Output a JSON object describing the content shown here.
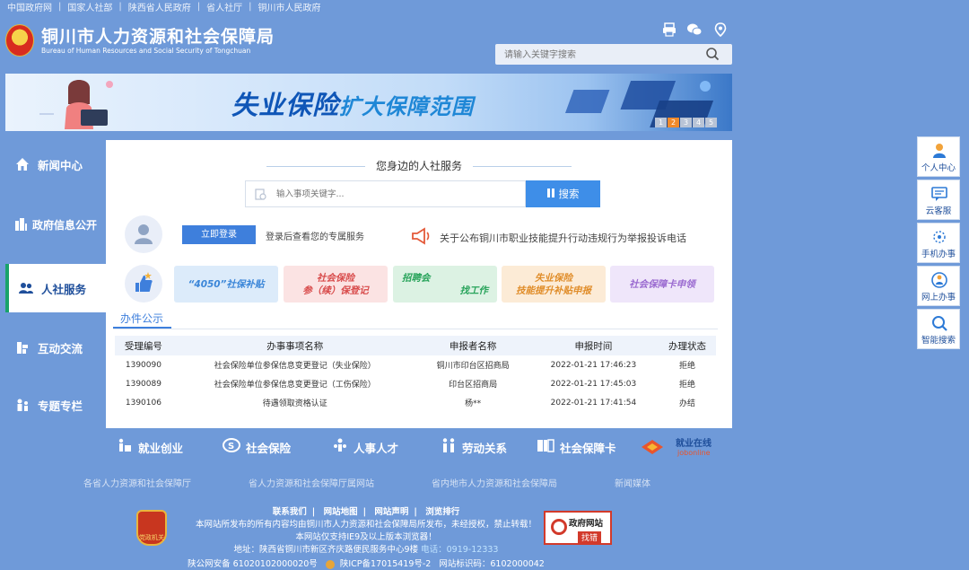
{
  "top_links": [
    "中国政府网",
    "国家人社部",
    "陕西省人民政府",
    "省人社厅",
    "铜川市人民政府"
  ],
  "header": {
    "title": "铜川市人力资源和社会保障局",
    "subtitle": "Bureau of Human Resources and Social Security of Tongchuan",
    "search_placeholder": "请输入关键字搜索",
    "icons": [
      "printer-icon",
      "wechat-icon",
      "location-icon"
    ]
  },
  "banner": {
    "title_main": "失业保险",
    "title_sub": "扩大保障范围",
    "pages": [
      "1",
      "2",
      "3",
      "4",
      "5"
    ],
    "active_page": "2"
  },
  "left_nav": [
    {
      "label": "新闻中心",
      "icon": "home-icon"
    },
    {
      "label": "政府信息公开",
      "icon": "building-icon"
    },
    {
      "label": "人社服务",
      "icon": "people-icon",
      "active": true
    },
    {
      "label": "互动交流",
      "icon": "chat-icon"
    },
    {
      "label": "专题专栏",
      "icon": "topic-icon"
    }
  ],
  "panel": {
    "heading": "您身边的人社服务",
    "search_placeholder": "输入事项关键字...",
    "search_button": "搜索",
    "login_button": "立即登录",
    "login_hint": "登录后查看您的专属服务",
    "notice": "关于公布铜川市职业技能提升行动违规行为举报投诉电话",
    "tiles": [
      {
        "line1": "“4050”社保补贴",
        "line2": "",
        "color": "#3b86d8",
        "bg": "#dcebfa"
      },
      {
        "line1": "社会保险",
        "line2": "参（续）保登记",
        "color": "#d84b4b",
        "bg": "#fbe3e3"
      },
      {
        "line1": "招聘会",
        "line2": "找工作",
        "color": "#27a35a",
        "bg": "#dcf2e3"
      },
      {
        "line1": "失业保险",
        "line2": "技能提升补贴申报",
        "color": "#e08d2a",
        "bg": "#fcebd6"
      },
      {
        "line1": "社会保障卡申领",
        "line2": "",
        "color": "#9a6ad0",
        "bg": "#efe6fa"
      }
    ],
    "pub_tab": "办件公示",
    "table": {
      "headers": [
        "受理编号",
        "办事事项名称",
        "申报者名称",
        "申报时间",
        "办理状态"
      ],
      "rows": [
        [
          "1390090",
          "社会保险单位参保信息变更登记（失业保险）",
          "铜川市印台区招商局",
          "2022-01-21 17:46:23",
          "拒绝"
        ],
        [
          "1390089",
          "社会保险单位参保信息变更登记（工伤保险）",
          "印台区招商局",
          "2022-01-21 17:45:03",
          "拒绝"
        ],
        [
          "1390106",
          "待遇领取资格认证",
          "杨**",
          "2022-01-21 17:41:54",
          "办结"
        ]
      ]
    }
  },
  "bottom_nav": [
    {
      "label": "就业创业",
      "icon": "job-icon"
    },
    {
      "label": "社会保险",
      "icon": "insurance-icon"
    },
    {
      "label": "人事人才",
      "icon": "talent-icon"
    },
    {
      "label": "劳动关系",
      "icon": "labor-icon"
    },
    {
      "label": "社会保障卡",
      "icon": "card-icon"
    }
  ],
  "job_online": {
    "cn": "就业在线",
    "en": "jobonline"
  },
  "link_groups": [
    "各省人力资源和社会保障厅",
    "省人力资源和社会保障厅属网站",
    "省内地市人力资源和社会保障局",
    "新闻媒体"
  ],
  "footer": {
    "links": [
      "联系我们",
      "网站地图",
      "网站声明",
      "浏览排行"
    ],
    "copyright": "本网站所发布的所有内容均由铜川市人力资源和社会保障局所发布，未经授权，禁止转载！",
    "browser": "本网站仅支持IE9及以上版本浏览器！",
    "address": "地址：陕西省铜川市新区齐庆路便民服务中心9楼",
    "tel": "电话：0919-12333",
    "police": "陕公网安备 61020102000020号",
    "icp": "陕ICP备17015419号-2",
    "site_code": "网站标识码：6102000042",
    "emblem_text": "党政机关",
    "gov_find_title": "政府网站",
    "gov_find_sub": "找错"
  },
  "right_bar": [
    {
      "label": "个人中心",
      "icon": "user-center-icon"
    },
    {
      "label": "云客服",
      "icon": "customer-service-icon"
    },
    {
      "label": "手机办事",
      "icon": "mobile-icon"
    },
    {
      "label": "网上办事",
      "icon": "online-service-icon",
      "highlight": true
    },
    {
      "label": "智能搜索",
      "icon": "search-icon"
    }
  ]
}
